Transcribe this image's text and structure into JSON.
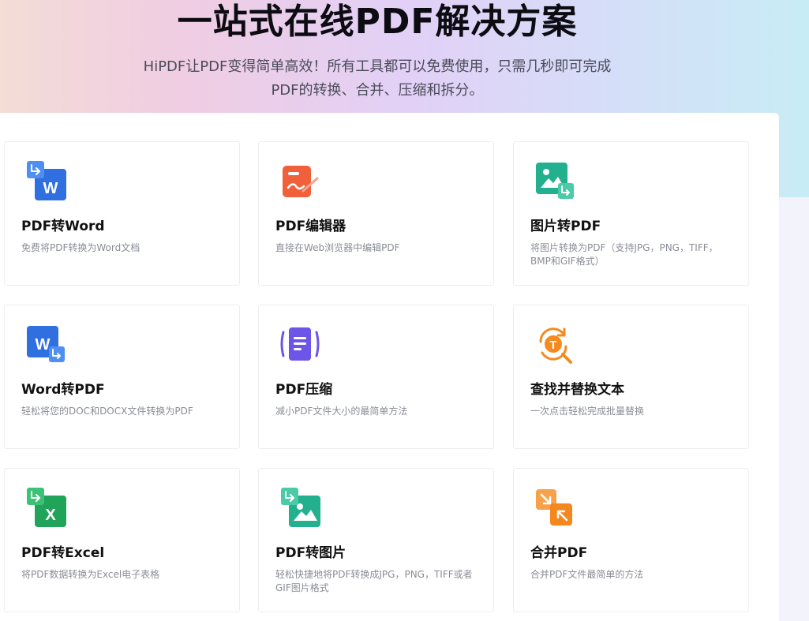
{
  "hero": {
    "title": "一站式在线PDF解决方案",
    "subtitle_line1": "HiPDF让PDF变得简单高效！所有工具都可以免费使用，只需几秒即可完成",
    "subtitle_line2": "PDF的转换、合并、压缩和拆分。"
  },
  "tools": [
    {
      "title": "PDF转Word",
      "desc": "免费将PDF转换为Word文档",
      "icon": "pdf-to-word-icon"
    },
    {
      "title": "PDF编辑器",
      "desc": "直接在Web浏览器中编辑PDF",
      "icon": "pdf-editor-icon"
    },
    {
      "title": "图片转PDF",
      "desc": "将图片转换为PDF（支持JPG，PNG，TIFF，BMP和GIF格式）",
      "icon": "image-to-pdf-icon"
    },
    {
      "title": "Word转PDF",
      "desc": "轻松将您的DOC和DOCX文件转换为PDF",
      "icon": "word-to-pdf-icon"
    },
    {
      "title": "PDF压缩",
      "desc": "减小PDF文件大小的最简单方法",
      "icon": "pdf-compress-icon"
    },
    {
      "title": "查找并替换文本",
      "desc": "一次点击轻松完成批量替换",
      "icon": "find-replace-icon"
    },
    {
      "title": "PDF转Excel",
      "desc": "将PDF数据转换为Excel电子表格",
      "icon": "pdf-to-excel-icon"
    },
    {
      "title": "PDF转图片",
      "desc": "轻松快捷地将PDF转换成JPG，PNG，TIFF或者GIF图片格式",
      "icon": "pdf-to-image-icon"
    },
    {
      "title": "合并PDF",
      "desc": "合并PDF文件最简单的方法",
      "icon": "merge-pdf-icon"
    }
  ],
  "colors": {
    "word_blue": "#2f6fe0",
    "editor_orange": "#f0603a",
    "image_teal": "#23b08e",
    "compress_purple": "#6d55e8",
    "find_orange": "#f58a1f",
    "excel_green": "#22a35a",
    "merge_orange": "#f5871f"
  }
}
